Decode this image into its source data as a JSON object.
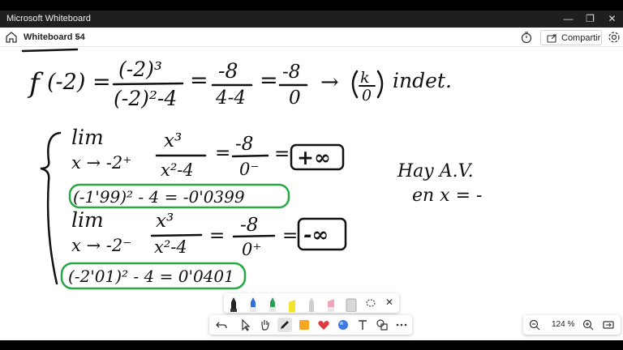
{
  "window": {
    "title": "Microsoft Whiteboard",
    "minimize": "—",
    "restore": "❐",
    "close": "✕"
  },
  "toolbar": {
    "board_name": "Whiteboard 54",
    "share_label": "Compartir"
  },
  "zoom": {
    "level": "124 %"
  },
  "colors": {
    "highlight_green": "#27a844",
    "pen_blue": "#2f6fd6",
    "pen_green": "#2aa052",
    "pen_yellow": "#f2e22a",
    "pen_pink": "#f3a6b8",
    "heart_red": "#e0393e",
    "sticky_orange": "#f6a623",
    "sphere_blue": "#3e78e6"
  },
  "ink": {
    "f_label": "f",
    "f_arg": "(-2) =",
    "frac1_num": "(-2)³",
    "frac1_den": "(-2)²-4",
    "eq_a": "=",
    "frac2_num": "-8",
    "frac2_den": "4-4",
    "eq_b": "=",
    "frac3_num": "-8",
    "frac3_den": "0",
    "arrow": "→",
    "k_num": "k",
    "k_den": "0",
    "indet": "indet.",
    "lim1": "lim",
    "lim1_sub": "x → -2⁺",
    "lim1_num": "x³",
    "lim1_den": "x²-4",
    "lim1_eq": "=",
    "lim1_rnum": "-8",
    "lim1_rden": "0⁻",
    "lim1_eq2": "=",
    "lim1_result": "+∞",
    "calc1": "(-1'99)² - 4 = -0'0399",
    "lim2": "lim",
    "lim2_sub": "x → -2⁻",
    "lim2_num": "x³",
    "lim2_den": "x²-4",
    "lim2_eq": "=",
    "lim2_rnum": "-8",
    "lim2_rden": "0⁺",
    "lim2_eq2": "=",
    "lim2_result": "-∞",
    "calc2": "(-2'01)² - 4 = 0'0401",
    "note1": "Hay A.V.",
    "note2": "en x = -"
  }
}
